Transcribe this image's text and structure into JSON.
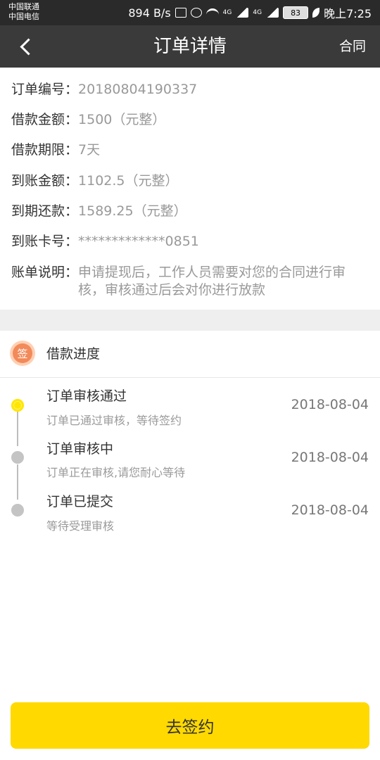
{
  "status_bar": {
    "carrier1": "中国联通",
    "carrier2": "中国电信",
    "speed": "894 B/s",
    "net1": "4G",
    "net2": "4G",
    "battery": "83",
    "time": "晚上7:25"
  },
  "header": {
    "title": "订单详情",
    "contract_label": "合同",
    "back_icon": "chevron-left-icon"
  },
  "order": {
    "rows": [
      {
        "label": "订单编号：",
        "value": "20180804190337"
      },
      {
        "label": "借款金额：",
        "value": "1500（元整）"
      },
      {
        "label": "借款期限：",
        "value": "7天"
      },
      {
        "label": "到账金额：",
        "value": "1102.5（元整）"
      },
      {
        "label": "到期还款：",
        "value": "1589.25（元整）"
      },
      {
        "label": "到账卡号：",
        "value": "*************0851"
      },
      {
        "label": "账单说明：",
        "value": "申请提现后，工作人员需要对您的合同进行审核，审核通过后会对你进行放款"
      }
    ]
  },
  "progress": {
    "badge_char": "签",
    "title": "借款进度",
    "steps": [
      {
        "title": "订单审核通过",
        "subtitle": "订单已通过审核，等待签约",
        "date": "2018-08-04"
      },
      {
        "title": "订单审核中",
        "subtitle": "订单正在审核,请您耐心等待",
        "date": "2018-08-04"
      },
      {
        "title": "订单已提交",
        "subtitle": "等待受理审核",
        "date": "2018-08-04"
      }
    ]
  },
  "action": {
    "sign_label": "去签约"
  },
  "colors": {
    "accent": "#ffd900",
    "header_bg": "#3a3a3a",
    "badge": "#f28a5a"
  }
}
